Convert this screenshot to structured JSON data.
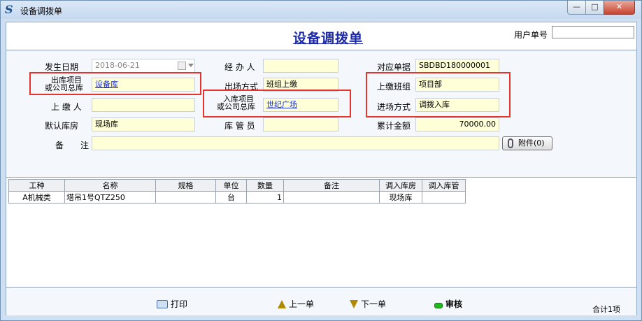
{
  "window": {
    "title": "设备调拨单",
    "icon": "s-logo-icon",
    "controls": {
      "minimize": "—",
      "maximize": "□",
      "close": "✕"
    }
  },
  "header": {
    "form_title": "设备调拨单",
    "user_no_label": "用户单号",
    "user_no_value": ""
  },
  "form": {
    "occur_date_label": "发生日期",
    "occur_date_value": "2018-06-21",
    "handler_label": "经 办 人",
    "handler_value": "",
    "ref_no_label": "对应单据",
    "ref_no_value": "SBDBD180000001",
    "out_project_label_1": "出库项目",
    "out_project_label_2": "或公司总库",
    "out_project_value": "设备库",
    "exit_mode_label": "出场方式",
    "exit_mode_value": "班组上缴",
    "handover_team_label": "上缴班组",
    "handover_team_value": "项目部",
    "submitter_label": "上 缴 人",
    "submitter_value": "",
    "in_project_label_1": "入库项目",
    "in_project_label_2": "或公司总库",
    "in_project_value": "世纪广场",
    "entry_mode_label": "进场方式",
    "entry_mode_value": "调拨入库",
    "default_store_label": "默认库房",
    "default_store_value": "现场库",
    "keeper_label": "库 管 员",
    "keeper_value": "",
    "total_amount_label": "累计金额",
    "total_amount_value": "70000.00",
    "remark_label": "备　　注",
    "remark_value": "",
    "attach_label": "附件(0)"
  },
  "grid": {
    "columns": [
      "工种",
      "名称",
      "规格",
      "单位",
      "数量",
      "备注",
      "调入库房",
      "调入库管"
    ],
    "rows": [
      [
        "A机械类",
        "塔吊1号QTZ250",
        "",
        "台",
        "1",
        "",
        "现场库",
        ""
      ]
    ]
  },
  "toolbar": {
    "print_label": "打印",
    "prev_label": "上一单",
    "next_label": "下一单",
    "audit_label": "审核",
    "summary": "合计1项"
  },
  "colors": {
    "title_blue": "#1c2aa9",
    "link_blue": "#1a2ed0",
    "field_yellow": "#ffffd8",
    "highlight_red": "#e8332c"
  }
}
